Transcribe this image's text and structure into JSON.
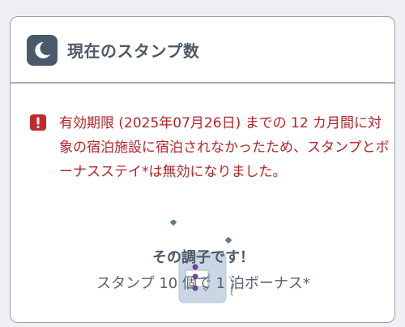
{
  "card": {
    "title": "現在のスタンプ数",
    "title_icon": "moon-icon"
  },
  "notice": {
    "icon": "exclamation-icon",
    "text": "有効期限 (2025年07月26日) までの 12 カ月間に対象の宿泊施設に宿泊されなかったため、スタンプとボーナスステイ*は無効になりました。",
    "color": "#b3262b"
  },
  "status": {
    "main": "その調子です！",
    "sub": "スタンプ 10 個で 1 泊ボーナス*"
  },
  "colors": {
    "header_icon_bg": "#4a5a6a",
    "alert_red": "#c4282d"
  }
}
